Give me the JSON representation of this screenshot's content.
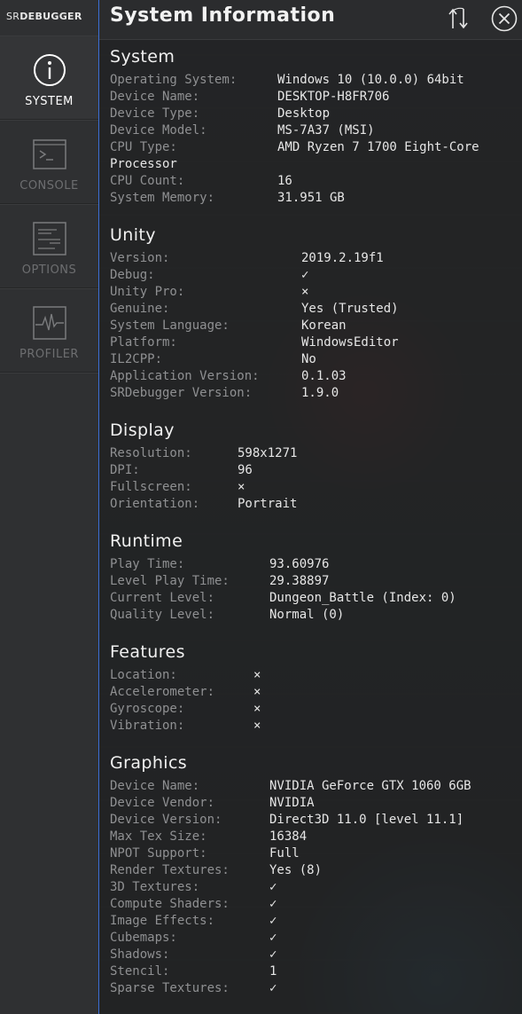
{
  "sidebar": {
    "logo_part1": "SR",
    "logo_part2": "DEBUGGER",
    "tabs": [
      {
        "label": "SYSTEM"
      },
      {
        "label": "CONSOLE"
      },
      {
        "label": "OPTIONS"
      },
      {
        "label": "PROFILER"
      }
    ]
  },
  "header": {
    "title": "System Information"
  },
  "sections": {
    "system": {
      "title": "System",
      "rows": [
        {
          "k": "Operating System:",
          "v": "Windows 10  (10.0.0) 64bit"
        },
        {
          "k": "Device Name:",
          "v": "DESKTOP-H8FR706"
        },
        {
          "k": "Device Type:",
          "v": "Desktop"
        },
        {
          "k": "Device Model:",
          "v": "MS-7A37 (MSI)"
        },
        {
          "k": "CPU Type:",
          "v": "AMD Ryzen 7 1700 Eight-Core"
        },
        {
          "k": "",
          "v": "Processor"
        },
        {
          "k": "CPU Count:",
          "v": "16"
        },
        {
          "k": "System Memory:",
          "v": "31.951 GB"
        }
      ]
    },
    "unity": {
      "title": "Unity",
      "rows": [
        {
          "k": "Version:",
          "v": "2019.2.19f1"
        },
        {
          "k": "Debug:",
          "v": "✓"
        },
        {
          "k": "Unity Pro:",
          "v": "×"
        },
        {
          "k": "Genuine:",
          "v": "Yes (Trusted)"
        },
        {
          "k": "System Language:",
          "v": "Korean"
        },
        {
          "k": "Platform:",
          "v": "WindowsEditor"
        },
        {
          "k": "IL2CPP:",
          "v": "No"
        },
        {
          "k": "Application Version:",
          "v": "0.1.03"
        },
        {
          "k": "SRDebugger Version:",
          "v": "1.9.0"
        }
      ]
    },
    "display": {
      "title": "Display",
      "rows": [
        {
          "k": "Resolution:",
          "v": "598x1271"
        },
        {
          "k": "DPI:",
          "v": "96"
        },
        {
          "k": "Fullscreen:",
          "v": "×"
        },
        {
          "k": "Orientation:",
          "v": "Portrait"
        }
      ]
    },
    "runtime": {
      "title": "Runtime",
      "rows": [
        {
          "k": "Play Time:",
          "v": "93.60976"
        },
        {
          "k": "Level Play Time:",
          "v": "29.38897"
        },
        {
          "k": "Current Level:",
          "v": "Dungeon_Battle (Index: 0)"
        },
        {
          "k": "Quality Level:",
          "v": "Normal (0)"
        }
      ]
    },
    "features": {
      "title": "Features",
      "rows": [
        {
          "k": "Location:",
          "v": "×"
        },
        {
          "k": "Accelerometer:",
          "v": "×"
        },
        {
          "k": "Gyroscope:",
          "v": "×"
        },
        {
          "k": "Vibration:",
          "v": "×"
        }
      ]
    },
    "graphics": {
      "title": "Graphics",
      "rows": [
        {
          "k": "Device Name:",
          "v": "NVIDIA GeForce GTX 1060 6GB"
        },
        {
          "k": "Device Vendor:",
          "v": "NVIDIA"
        },
        {
          "k": "Device Version:",
          "v": "Direct3D 11.0 [level 11.1]"
        },
        {
          "k": "Max Tex Size:",
          "v": "16384"
        },
        {
          "k": "NPOT Support:",
          "v": "Full"
        },
        {
          "k": "Render Textures:",
          "v": "Yes (8)"
        },
        {
          "k": "3D Textures:",
          "v": "✓"
        },
        {
          "k": "Compute Shaders:",
          "v": "✓"
        },
        {
          "k": "Image Effects:",
          "v": "✓"
        },
        {
          "k": "Cubemaps:",
          "v": "✓"
        },
        {
          "k": "Shadows:",
          "v": "✓"
        },
        {
          "k": "Stencil:",
          "v": "1"
        },
        {
          "k": "Sparse Textures:",
          "v": "✓"
        }
      ]
    }
  }
}
